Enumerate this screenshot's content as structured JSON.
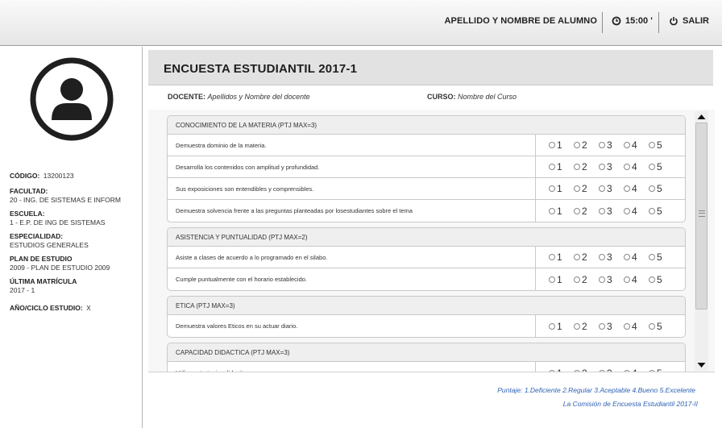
{
  "topbar": {
    "student_name": "APELLIDO Y NOMBRE DE ALUMNO",
    "time": "15:00 '",
    "logout_label": "SALIR"
  },
  "sidebar": {
    "codigo_label": "CÓDIGO:",
    "codigo_value": "13200123",
    "facultad_label": "FACULTAD:",
    "facultad_value": "20 - ING. DE SISTEMAS E INFORM",
    "escuela_label": "ESCUELA:",
    "escuela_value": "1 - E.P. DE ING DE SISTEMAS",
    "especialidad_label": "ESPECIALIDAD:",
    "especialidad_value": "ESTUDIOS GENERALES",
    "plan_label": "PLAN DE ESTUDIO",
    "plan_value": "2009 - PLAN DE ESTUDIO 2009",
    "matricula_label": "ÚLTIMA MATRÍCULA",
    "matricula_value": "2017 - 1",
    "ciclo_label": "AÑO/CICLO ESTUDIO:",
    "ciclo_value": "X"
  },
  "header": {
    "title": "ENCUESTA ESTUDIANTIL 2017-1",
    "docente_label": "DOCENTE:",
    "docente_value": "Apellidos y Nombre del docente",
    "curso_label": "CURSO:",
    "curso_value": "Nombre del Curso"
  },
  "sections": [
    {
      "title": "CONOCIMIENTO DE LA MATERIA (PTJ MAX=3)",
      "questions": [
        "Demuestra dominio de la materia.",
        "Desarrolla los contenidos con amplitud y profundidad.",
        "Sus exposiciones son entendibles y comprensibles.",
        "Demuestra solvencia frente a las preguntas planteadas por losestudiantes sobre el tema"
      ]
    },
    {
      "title": "ASISTENCIA Y PUNTUALIDAD (PTJ MAX=2)",
      "questions": [
        "Asiste a clases de acuerdo a lo programado en el silabo.",
        "Cumple puntualmente con el horario establecido."
      ]
    },
    {
      "title": "ETICA (PTJ MAX=3)",
      "questions": [
        "Demuestra valores Eticos en su actuar diario."
      ]
    },
    {
      "title": "CAPACIDAD DIDACTICA (PTJ MAX=3)",
      "questions": [
        "Utiliza estrategias didacticas"
      ]
    }
  ],
  "options": [
    "1",
    "2",
    "3",
    "4",
    "5"
  ],
  "footer": {
    "scale": "Puntaje: 1.Deficiente 2.Regular 3.Aceptable 4.Bueno 5.Excelente",
    "commission": "La Comisión de Encuesta Estudiantil 2017-II"
  }
}
